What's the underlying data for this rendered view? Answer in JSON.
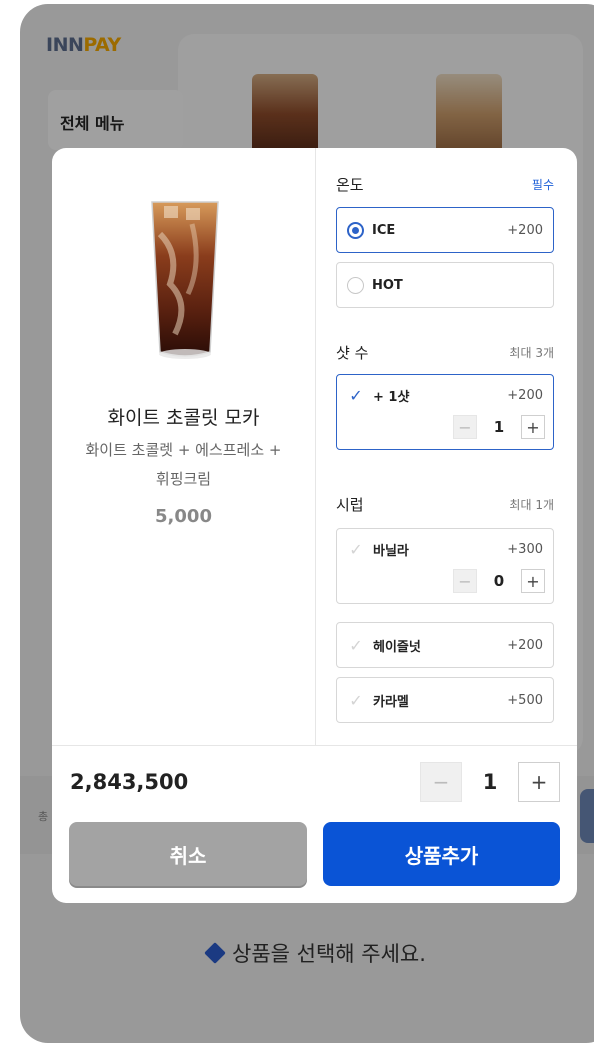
{
  "brand": {
    "logo_part1": "INN",
    "logo_part2": "PAY"
  },
  "background": {
    "menu_tab": "전체 메뉴",
    "bottom_text": "총",
    "hint": "상품을 선택해 주세요."
  },
  "product": {
    "name": "화이트 초콜릿 모카",
    "description": "화이트 초콜렛 + 에스프레소 + 휘핑크림",
    "price": "5,000"
  },
  "options": {
    "temperature": {
      "title": "온도",
      "note": "필수",
      "items": [
        {
          "label": "ICE",
          "price": "+200",
          "selected": true
        },
        {
          "label": "HOT",
          "price": "",
          "selected": false
        }
      ]
    },
    "shots": {
      "title": "샷 수",
      "note": "최대 3개",
      "items": [
        {
          "label": "+ 1샷",
          "price": "+200",
          "checked": true,
          "qty": "1"
        }
      ]
    },
    "syrup": {
      "title": "시럽",
      "note": "최대 1개",
      "items": [
        {
          "label": "바닐라",
          "price": "+300",
          "checked": false,
          "qty": "0"
        },
        {
          "label": "헤이즐넛",
          "price": "+200",
          "checked": false
        },
        {
          "label": "카라멜",
          "price": "+500",
          "checked": false
        }
      ]
    }
  },
  "footer": {
    "total": "2,843,500",
    "quantity": "1",
    "cancel_label": "취소",
    "add_label": "상품추가"
  },
  "icons": {
    "minus": "−",
    "plus": "+",
    "check": "✓"
  },
  "colors": {
    "accent": "#0a54d6",
    "selected_border": "#2d63c8",
    "cancel": "#a3a3a3"
  }
}
